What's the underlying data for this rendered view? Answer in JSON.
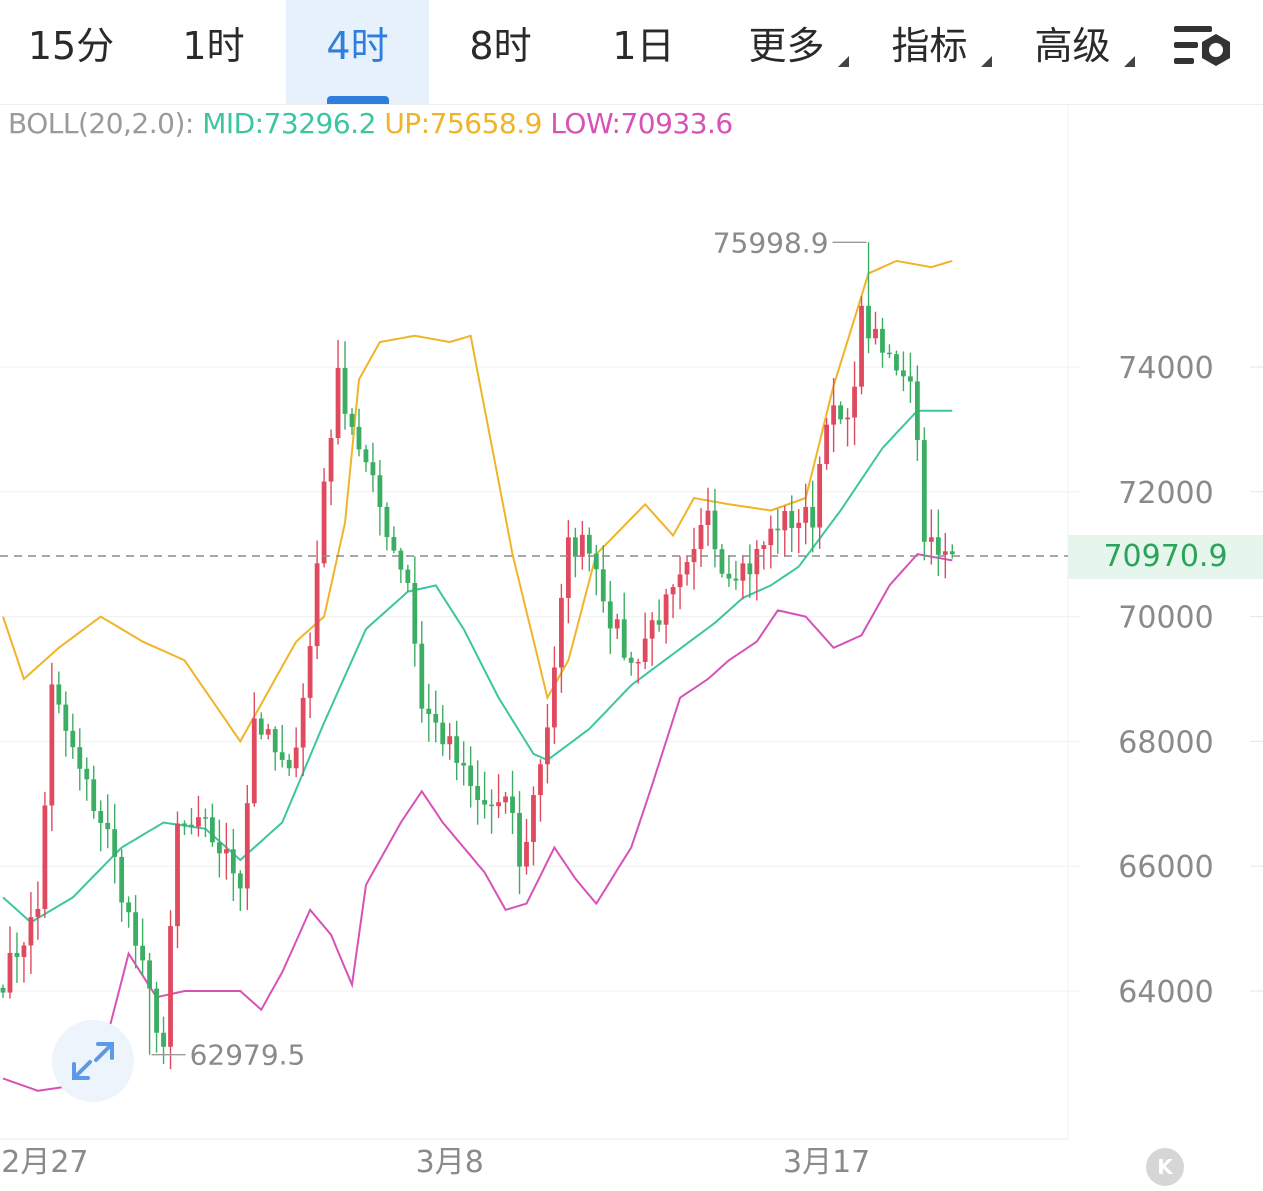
{
  "toolbar": {
    "tabs": [
      {
        "label": "15分"
      },
      {
        "label": "1时"
      },
      {
        "label": "4时"
      },
      {
        "label": "8时"
      },
      {
        "label": "1日"
      },
      {
        "label": "更多"
      },
      {
        "label": "指标"
      },
      {
        "label": "高级"
      }
    ],
    "active_tab": "4时",
    "settings_icon": "chart-settings-icon"
  },
  "legend": {
    "name": "BOLL(20,2.0):",
    "mid": "MID:73296.2",
    "up": "UP:75658.9",
    "low": "LOW:70933.6"
  },
  "colors": {
    "up_candle": "#e04a5f",
    "down_candle": "#3cae63",
    "mid": "#3cc6a0",
    "upper": "#f0b429",
    "lower": "#d752b8",
    "accent": "#2f7ddd"
  },
  "current_price": "70970.9",
  "max_label": "75998.9",
  "min_label": "62979.5",
  "chart_data": {
    "type": "candlestick",
    "title": "",
    "y_ticks": [
      64000,
      66000,
      68000,
      70000,
      72000,
      74000
    ],
    "x_ticks": [
      {
        "index": 6,
        "label": "2月27"
      },
      {
        "index": 64,
        "label": "3月8"
      },
      {
        "index": 118,
        "label": "3月17"
      }
    ],
    "current_price": 70970.9,
    "max": {
      "value": 75998.9,
      "label": "75998.9"
    },
    "min": {
      "value": 62979.5,
      "label": "62979.5"
    },
    "boll_keyframes": {
      "mid": [
        [
          0,
          65500
        ],
        [
          4,
          65100
        ],
        [
          10,
          65500
        ],
        [
          17,
          66300
        ],
        [
          23,
          66700
        ],
        [
          29,
          66600
        ],
        [
          34,
          66100
        ],
        [
          40,
          66700
        ],
        [
          46,
          68300
        ],
        [
          52,
          69800
        ],
        [
          58,
          70400
        ],
        [
          62,
          70500
        ],
        [
          66,
          69800
        ],
        [
          71,
          68700
        ],
        [
          76,
          67800
        ],
        [
          78,
          67700
        ],
        [
          84,
          68200
        ],
        [
          90,
          68900
        ],
        [
          96,
          69400
        ],
        [
          102,
          69900
        ],
        [
          106,
          70300
        ],
        [
          110,
          70500
        ],
        [
          114,
          70800
        ],
        [
          120,
          71700
        ],
        [
          126,
          72700
        ],
        [
          131,
          73300
        ],
        [
          136,
          73300
        ]
      ],
      "upper": [
        [
          0,
          70000
        ],
        [
          3,
          69000
        ],
        [
          8,
          69500
        ],
        [
          14,
          70000
        ],
        [
          20,
          69600
        ],
        [
          26,
          69300
        ],
        [
          34,
          68000
        ],
        [
          42,
          69600
        ],
        [
          46,
          70000
        ],
        [
          49,
          71500
        ],
        [
          51,
          73800
        ],
        [
          54,
          74400
        ],
        [
          59,
          74500
        ],
        [
          64,
          74400
        ],
        [
          67,
          74500
        ],
        [
          73,
          71000
        ],
        [
          78,
          68700
        ],
        [
          81,
          69300
        ],
        [
          85,
          71000
        ],
        [
          92,
          71800
        ],
        [
          96,
          71300
        ],
        [
          99,
          71900
        ],
        [
          104,
          71800
        ],
        [
          110,
          71700
        ],
        [
          115,
          71900
        ],
        [
          119,
          73700
        ],
        [
          124,
          75500
        ],
        [
          128,
          75700
        ],
        [
          133,
          75600
        ],
        [
          136,
          75700
        ]
      ],
      "lower": [
        [
          0,
          62600
        ],
        [
          5,
          62400
        ],
        [
          11,
          62500
        ],
        [
          15,
          63300
        ],
        [
          18,
          64600
        ],
        [
          22,
          63900
        ],
        [
          26,
          64000
        ],
        [
          30,
          64000
        ],
        [
          34,
          64000
        ],
        [
          37,
          63700
        ],
        [
          40,
          64300
        ],
        [
          44,
          65300
        ],
        [
          47,
          64900
        ],
        [
          50,
          64100
        ],
        [
          52,
          65700
        ],
        [
          57,
          66700
        ],
        [
          60,
          67200
        ],
        [
          63,
          66700
        ],
        [
          69,
          65900
        ],
        [
          72,
          65300
        ],
        [
          75,
          65400
        ],
        [
          79,
          66300
        ],
        [
          82,
          65800
        ],
        [
          85,
          65400
        ],
        [
          90,
          66300
        ],
        [
          93,
          67300
        ],
        [
          97,
          68700
        ],
        [
          101,
          69000
        ],
        [
          104,
          69300
        ],
        [
          108,
          69600
        ],
        [
          111,
          70100
        ],
        [
          115,
          70000
        ],
        [
          119,
          69500
        ],
        [
          123,
          69700
        ],
        [
          127,
          70500
        ],
        [
          131,
          71000
        ],
        [
          136,
          70900
        ]
      ]
    },
    "candle_keyframes": [
      [
        0,
        64200
      ],
      [
        5,
        65300
      ],
      [
        7,
        68800
      ],
      [
        11,
        67500
      ],
      [
        15,
        66500
      ],
      [
        20,
        64300
      ],
      [
        23,
        63100
      ],
      [
        25,
        66600
      ],
      [
        29,
        66600
      ],
      [
        34,
        65800
      ],
      [
        36,
        68400
      ],
      [
        41,
        67400
      ],
      [
        44,
        69500
      ],
      [
        46,
        72200
      ],
      [
        48,
        73800
      ],
      [
        52,
        72400
      ],
      [
        56,
        71100
      ],
      [
        58,
        70600
      ],
      [
        60,
        68600
      ],
      [
        64,
        67900
      ],
      [
        68,
        67000
      ],
      [
        73,
        66900
      ],
      [
        74,
        65900
      ],
      [
        78,
        68300
      ],
      [
        81,
        71100
      ],
      [
        84,
        71200
      ],
      [
        87,
        70000
      ],
      [
        90,
        69200
      ],
      [
        93,
        69900
      ],
      [
        96,
        70300
      ],
      [
        99,
        70900
      ],
      [
        101,
        71800
      ],
      [
        103,
        70800
      ],
      [
        107,
        70800
      ],
      [
        111,
        71500
      ],
      [
        116,
        71600
      ],
      [
        118,
        73300
      ],
      [
        121,
        73000
      ],
      [
        123,
        74800
      ],
      [
        126,
        74200
      ],
      [
        130,
        73900
      ],
      [
        131,
        72800
      ],
      [
        132,
        71400
      ],
      [
        134,
        70900
      ],
      [
        136,
        71000
      ]
    ]
  }
}
